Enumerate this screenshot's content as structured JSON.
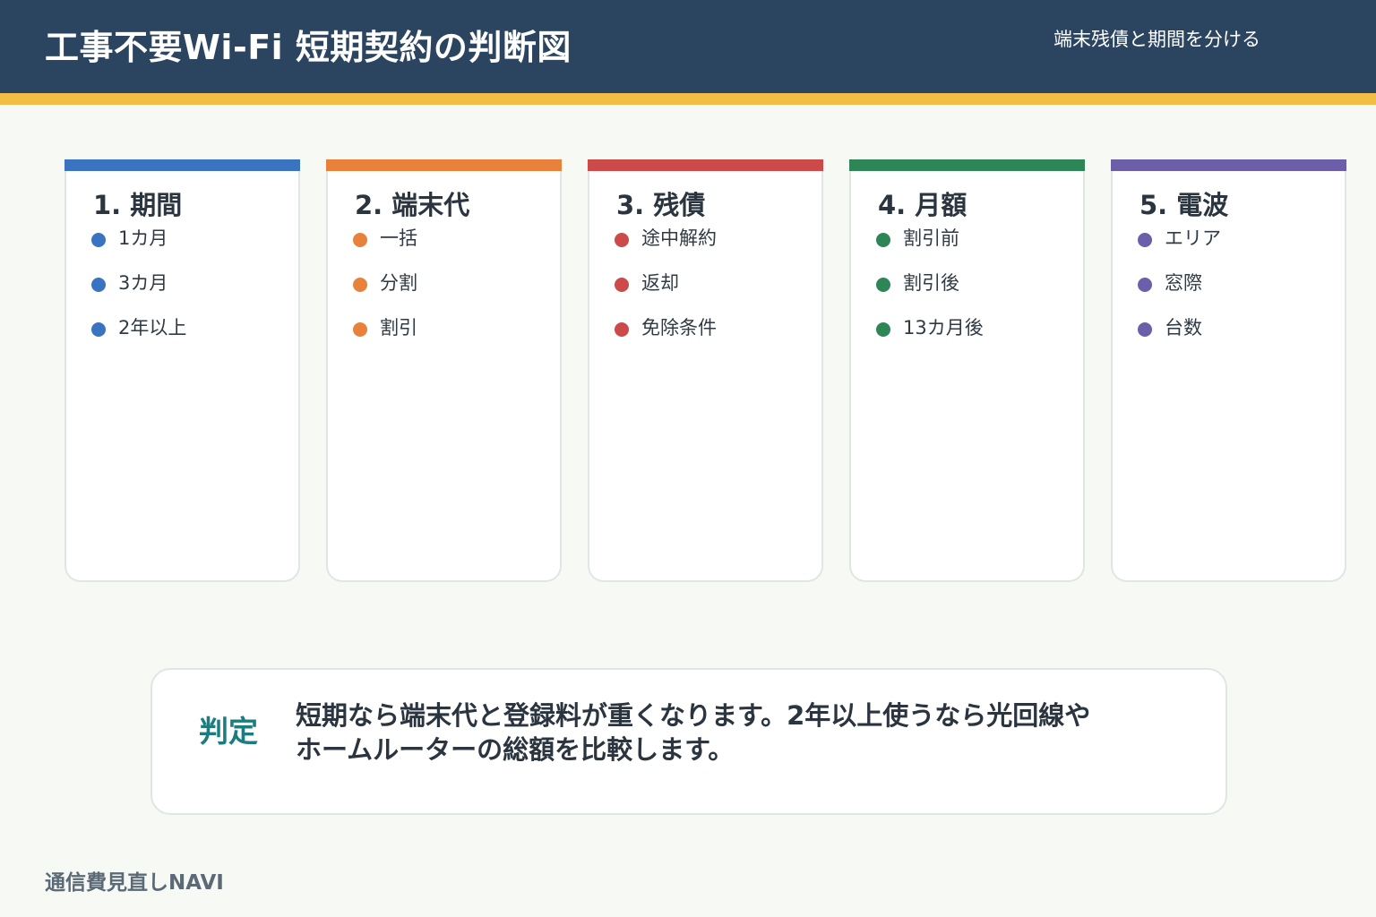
{
  "header": {
    "title": "工事不要Wi-Fi 短期契約の判断図",
    "subtitle": "端末残債と期間を分ける"
  },
  "colors": {
    "header_bg": "#2b4560",
    "header_stripe": "#f2bd45",
    "accent_teal": "#1b7d80"
  },
  "cards": [
    {
      "title": "1. 期間",
      "color": "#3a73bf",
      "items": [
        "1カ月",
        "3カ月",
        "2年以上"
      ]
    },
    {
      "title": "2. 端末代",
      "color": "#e8813c",
      "items": [
        "一括",
        "分割",
        "割引"
      ]
    },
    {
      "title": "3. 残債",
      "color": "#cc4a4a",
      "items": [
        "途中解約",
        "返却",
        "免除条件"
      ]
    },
    {
      "title": "4. 月額",
      "color": "#2e8656",
      "items": [
        "割引前",
        "割引後",
        "13カ月後"
      ]
    },
    {
      "title": "5. 電波",
      "color": "#6c5ea8",
      "items": [
        "エリア",
        "窓際",
        "台数"
      ]
    }
  ],
  "verdict": {
    "label": "判定",
    "line1": "短期なら端末代と登録料が重くなります。2年以上使うなら光回線や",
    "line2": "ホームルーターの総額を比較します。"
  },
  "footer": {
    "brand": "通信費見直しNAVI"
  }
}
